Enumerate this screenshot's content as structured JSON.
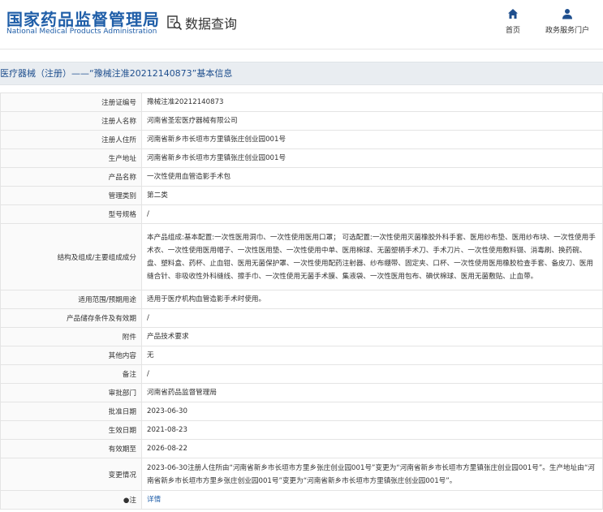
{
  "header": {
    "brand_cn": "国家药品监督管理局",
    "brand_en": "National Medical Products Administration",
    "query_label": "数据查询",
    "nav": [
      {
        "label": "首页"
      },
      {
        "label": "政务服务门户"
      }
    ]
  },
  "page_title": "医疗器械（注册）——“豫械注准20212140873”基本信息",
  "rows": [
    {
      "label": "注册证编号",
      "value": "豫械注准20212140873"
    },
    {
      "label": "注册人名称",
      "value": "河南省圣宏医疗器械有限公司"
    },
    {
      "label": "注册人住所",
      "value": "河南省新乡市长垣市方里镇张庄创业园001号"
    },
    {
      "label": "生产地址",
      "value": "河南省新乡市长垣市方里镇张庄创业园001号"
    },
    {
      "label": "产品名称",
      "value": "一次性使用血管造影手术包"
    },
    {
      "label": "管理类别",
      "value": "第二类"
    },
    {
      "label": "型号规格",
      "value": "/"
    },
    {
      "label": "结构及组成/主要组成成分",
      "value": "本产品组成:基本配置:一次性医用洞巾、一次性使用医用口罩； 可选配置:一次性使用灭菌橡胶外科手套、医用纱布垫、医用纱布块、一次性使用手术衣、一次性使用医用帽子、一次性医用垫、一次性使用中单、医用棉球、无菌塑柄手术刀、手术刀片、一次性使用敷料镊、消毒刷、换药碗、盘、塑料盒、药杯、止血钳、医用无菌保护罩、一次性使用配药注射器、纱布绷带、固定夹、口杯、一次性使用医用橡胶检查手套、备皮刀、医用缝合针、非吸收性外科缝线、擦手巾、一次性使用无菌手术膜、集液袋、一次性医用包布、碘伏棉球、医用无菌敷贴、止血带。"
    },
    {
      "label": "适用范围/预期用途",
      "value": "适用于医疗机构血管造影手术时使用。"
    },
    {
      "label": "产品储存条件及有效期",
      "value": "/"
    },
    {
      "label": "附件",
      "value": "产品技术要求"
    },
    {
      "label": "其他内容",
      "value": "无"
    },
    {
      "label": "备注",
      "value": "/"
    },
    {
      "label": "审批部门",
      "value": "河南省药品监督管理局"
    },
    {
      "label": "批准日期",
      "value": "2023-06-30"
    },
    {
      "label": "生效日期",
      "value": "2021-08-23"
    },
    {
      "label": "有效期至",
      "value": "2026-08-22"
    },
    {
      "label": "变更情况",
      "value": "2023-06-30注册人住所由“河南省新乡市长垣市方里乡张庄创业园001号”变更为“河南省新乡市长垣市方里镇张庄创业园001号”。生产地址由“河南省新乡市长垣市方里乡张庄创业园001号”变更为“河南省新乡市长垣市方里镇张庄创业园001号”。"
    }
  ],
  "note_row": {
    "bullet": "●",
    "label": "注",
    "link": "详情"
  }
}
